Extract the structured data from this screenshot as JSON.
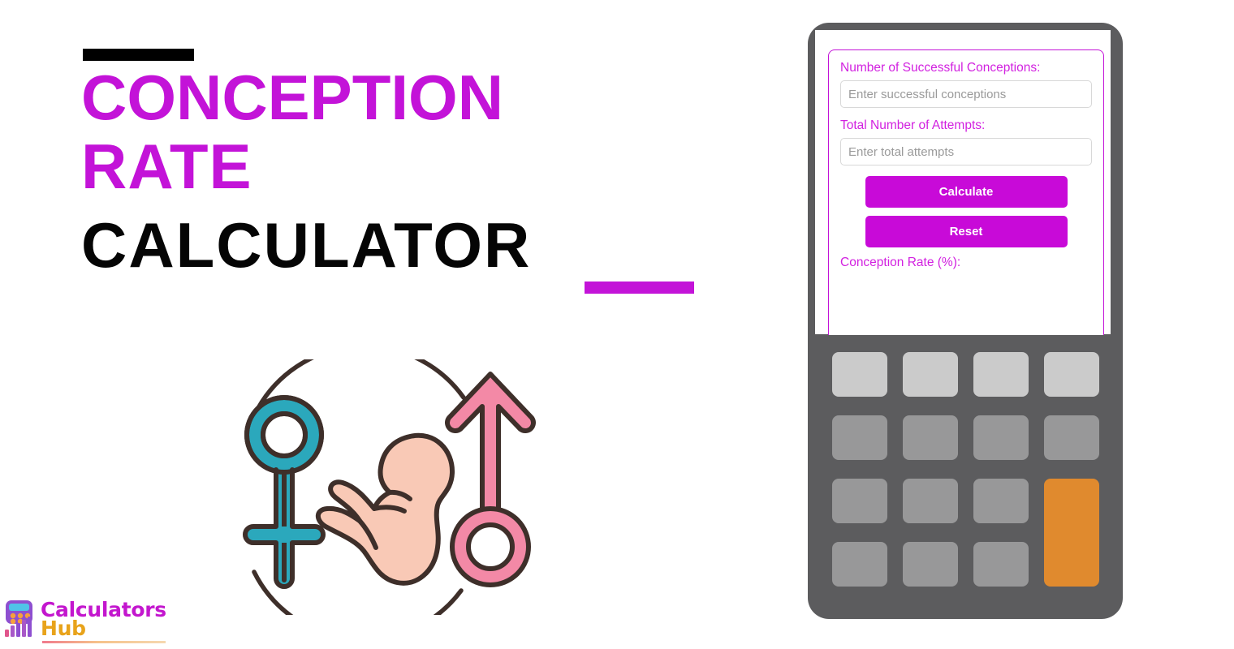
{
  "page": {
    "background_color": "#ffffff",
    "accent_color": "#C313D8",
    "dark_color": "#050505"
  },
  "title": {
    "line1": "CONCEPTION",
    "line2": "RATE",
    "line3": "CALCULATOR",
    "rule_top_color": "#000000",
    "rule_bottom_color": "#C313D8"
  },
  "illustration": {
    "name": "conception-illustration",
    "female_symbol_color": "#2BA8BC",
    "male_symbol_color": "#F389A6",
    "fetus_color": "#F9C9B6",
    "outline_color": "#3E2F2A"
  },
  "logo": {
    "word1": "Calculators",
    "word2": "Hub",
    "word1_color": "#C317CE",
    "word2_color": "#E8A31B"
  },
  "calculator": {
    "frame_color": "#5C5C5E",
    "screen": {
      "border_color": "#C313D8",
      "fields": [
        {
          "label": "Number of Successful Conceptions:",
          "placeholder": "Enter successful conceptions",
          "value": ""
        },
        {
          "label": "Total Number of Attempts:",
          "placeholder": "Enter total attempts",
          "value": ""
        }
      ],
      "buttons": [
        {
          "label": "Calculate",
          "color": "#C80AD8"
        },
        {
          "label": "Reset",
          "color": "#C80AD8"
        }
      ],
      "result_label": "Conception Rate (%):",
      "result_value": ""
    },
    "keypad": {
      "rows": 4,
      "columns": 4,
      "key_color": "#989899",
      "top_row_color": "#CBCBCB",
      "accent_key_color": "#E08A2E",
      "keys": [
        {
          "label": "",
          "style": "light"
        },
        {
          "label": "",
          "style": "light"
        },
        {
          "label": "",
          "style": "light"
        },
        {
          "label": "",
          "style": "light"
        },
        {
          "label": "",
          "style": "normal"
        },
        {
          "label": "",
          "style": "normal"
        },
        {
          "label": "",
          "style": "normal"
        },
        {
          "label": "",
          "style": "normal"
        },
        {
          "label": "",
          "style": "normal"
        },
        {
          "label": "",
          "style": "normal"
        },
        {
          "label": "",
          "style": "normal"
        },
        {
          "label": "",
          "style": "normal"
        },
        {
          "label": "",
          "style": "normal"
        },
        {
          "label": "",
          "style": "normal"
        }
      ],
      "accent_key": {
        "label": "",
        "style": "accent"
      }
    }
  }
}
